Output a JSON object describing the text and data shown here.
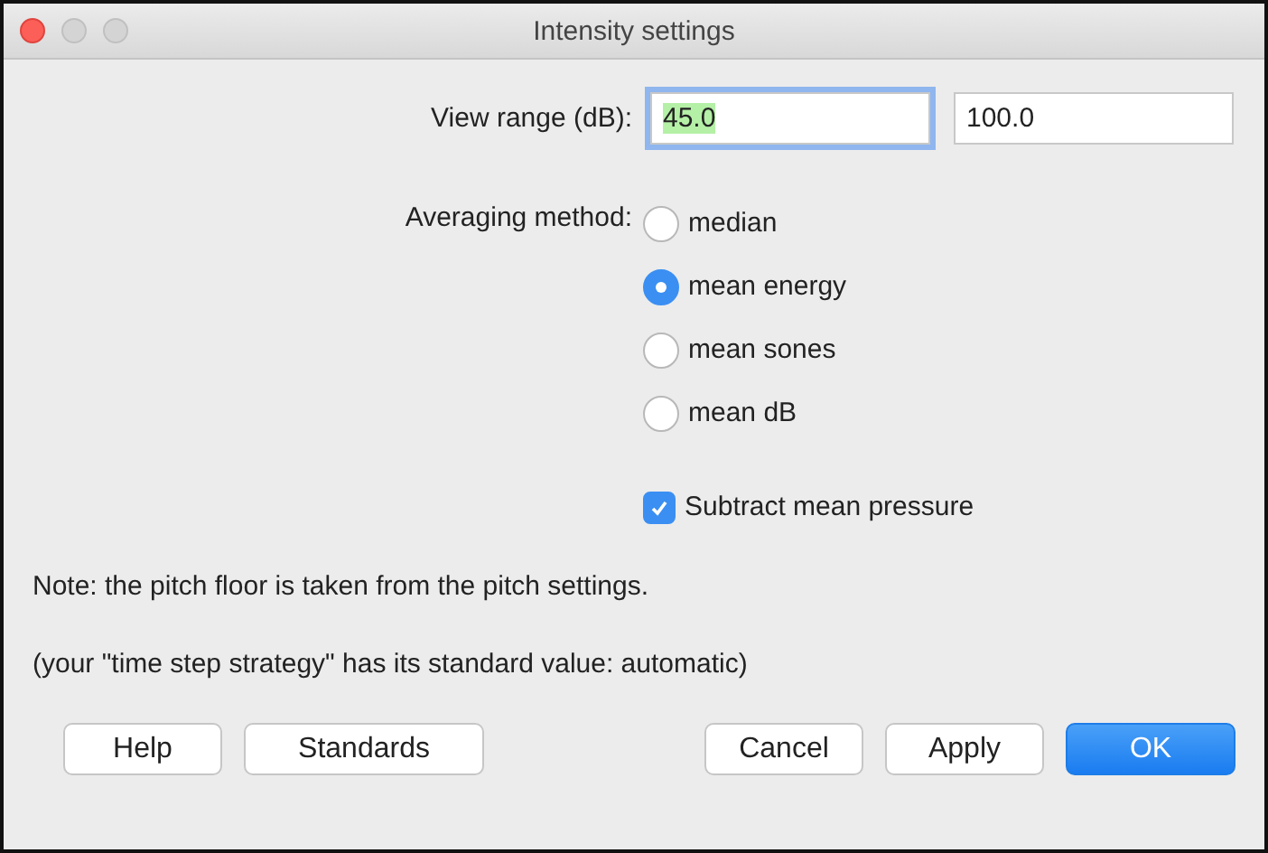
{
  "window": {
    "title": "Intensity settings"
  },
  "view_range": {
    "label": "View range (dB):",
    "from": {
      "value": "45.0",
      "focused": true
    },
    "to": {
      "value": "100.0",
      "focused": false
    }
  },
  "averaging": {
    "label": "Averaging method:",
    "options": [
      {
        "label": "median",
        "selected": false
      },
      {
        "label": "mean energy",
        "selected": true
      },
      {
        "label": "mean sones",
        "selected": false
      },
      {
        "label": "mean dB",
        "selected": false
      }
    ]
  },
  "subtract_mean_pressure": {
    "label": "Subtract mean pressure",
    "checked": true
  },
  "notes": [
    "Note: the pitch floor is taken from the pitch settings.",
    "(your \"time step strategy\" has its standard value: automatic)"
  ],
  "buttons_left": [
    {
      "label": "Help",
      "primary": false
    },
    {
      "label": "Standards",
      "primary": false
    }
  ],
  "buttons_right": [
    {
      "label": "Cancel",
      "primary": false
    },
    {
      "label": "Apply",
      "primary": false
    },
    {
      "label": "OK",
      "primary": true
    }
  ]
}
